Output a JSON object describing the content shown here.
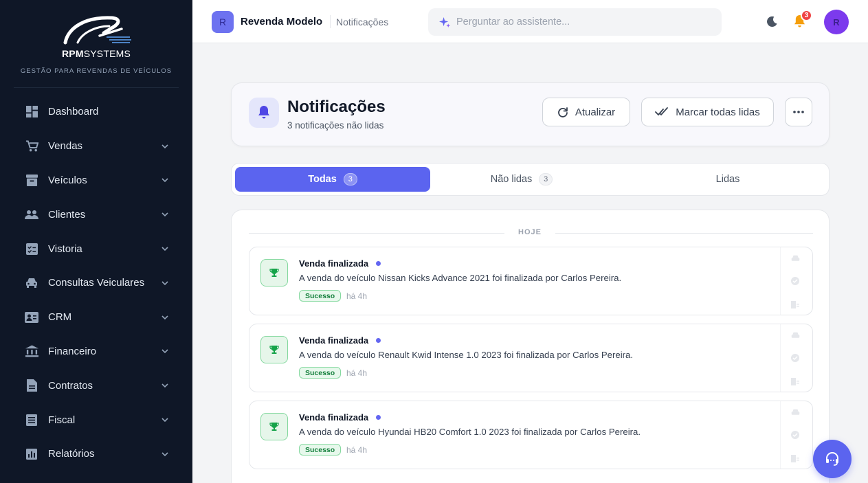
{
  "brand": {
    "name_bold": "RPM",
    "name_rest": "SYSTEMS",
    "tagline": "GESTÃO PARA REVENDAS DE VEÍCULOS"
  },
  "sidebar": {
    "items": [
      {
        "label": "Dashboard",
        "icon": "dashboard-icon"
      },
      {
        "label": "Vendas",
        "icon": "cart-icon"
      },
      {
        "label": "Veículos",
        "icon": "archive-icon"
      },
      {
        "label": "Clientes",
        "icon": "people-icon"
      },
      {
        "label": "Vistoria",
        "icon": "checklist-icon"
      },
      {
        "label": "Consultas Veiculares",
        "icon": "car-icon"
      },
      {
        "label": "CRM",
        "icon": "contact-card-icon"
      },
      {
        "label": "Financeiro",
        "icon": "bank-icon"
      },
      {
        "label": "Contratos",
        "icon": "document-icon"
      },
      {
        "label": "Fiscal",
        "icon": "receipt-icon"
      },
      {
        "label": "Relatórios",
        "icon": "report-icon"
      }
    ]
  },
  "topbar": {
    "store_initial": "R",
    "store_name": "Revenda Modelo",
    "breadcrumb": "Notificações",
    "assistant_placeholder": "Perguntar ao assistente...",
    "notification_count": "3",
    "user_initial": "R"
  },
  "page": {
    "title": "Notificações",
    "subtitle": "3 notificações não lidas",
    "refresh_label": "Atualizar",
    "mark_all_label": "Marcar todas lidas"
  },
  "tabs": {
    "all": {
      "label": "Todas",
      "count": "3"
    },
    "unread": {
      "label": "Não lidas",
      "count": "3"
    },
    "read": {
      "label": "Lidas"
    }
  },
  "list": {
    "group_label": "HOJE",
    "items": [
      {
        "title": "Venda finalizada",
        "text": "A venda do veículo Nissan Kicks Advance 2021 foi finalizada por Carlos Pereira.",
        "badge": "Sucesso",
        "time": "há 4h"
      },
      {
        "title": "Venda finalizada",
        "text": "A venda do veículo Renault Kwid Intense 1.0 2023 foi finalizada por Carlos Pereira.",
        "badge": "Sucesso",
        "time": "há 4h"
      },
      {
        "title": "Venda finalizada",
        "text": "A venda do veículo Hyundai HB20 Comfort 1.0 2023 foi finalizada por Carlos Pereira.",
        "badge": "Sucesso",
        "time": "há 4h"
      }
    ]
  },
  "colors": {
    "sidebar_bg": "#0f1727",
    "accent": "#5b64ef",
    "success": "#15803d",
    "danger": "#ef4444"
  }
}
